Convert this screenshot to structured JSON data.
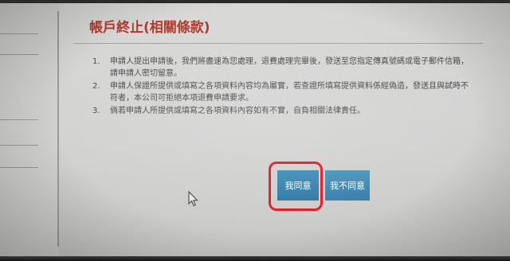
{
  "page": {
    "title": "帳戶終止(相關條款)"
  },
  "sidebar": {
    "items": [
      {
        "label": ""
      },
      {
        "label": ""
      },
      {
        "label": ""
      },
      {
        "label": ""
      },
      {
        "label": ""
      },
      {
        "label": ""
      }
    ]
  },
  "terms": [
    {
      "num": "1.",
      "text": "申請人提出申請後，我們將盡速為您處理，退費處理完畢後，發送至您指定傳真號碼或電子郵件信箱，請申請人密切留意。"
    },
    {
      "num": "2.",
      "text": "申請人保證所提供或填寫之各項資料內容均為屬實，若查證所填寫提供資料係經偽造，發送且與試時不符者，本公司可拒絕本項退費申請要求。"
    },
    {
      "num": "3.",
      "text": "倘若申請人所提供或填寫之各項資料內容如有不實，自負相關法律責任。"
    }
  ],
  "actions": {
    "agree_label": "我同意",
    "disagree_label": "我不同意"
  },
  "colors": {
    "title": "#b03a2e",
    "button": "#2f7aa6",
    "highlight": "#e51c23"
  }
}
